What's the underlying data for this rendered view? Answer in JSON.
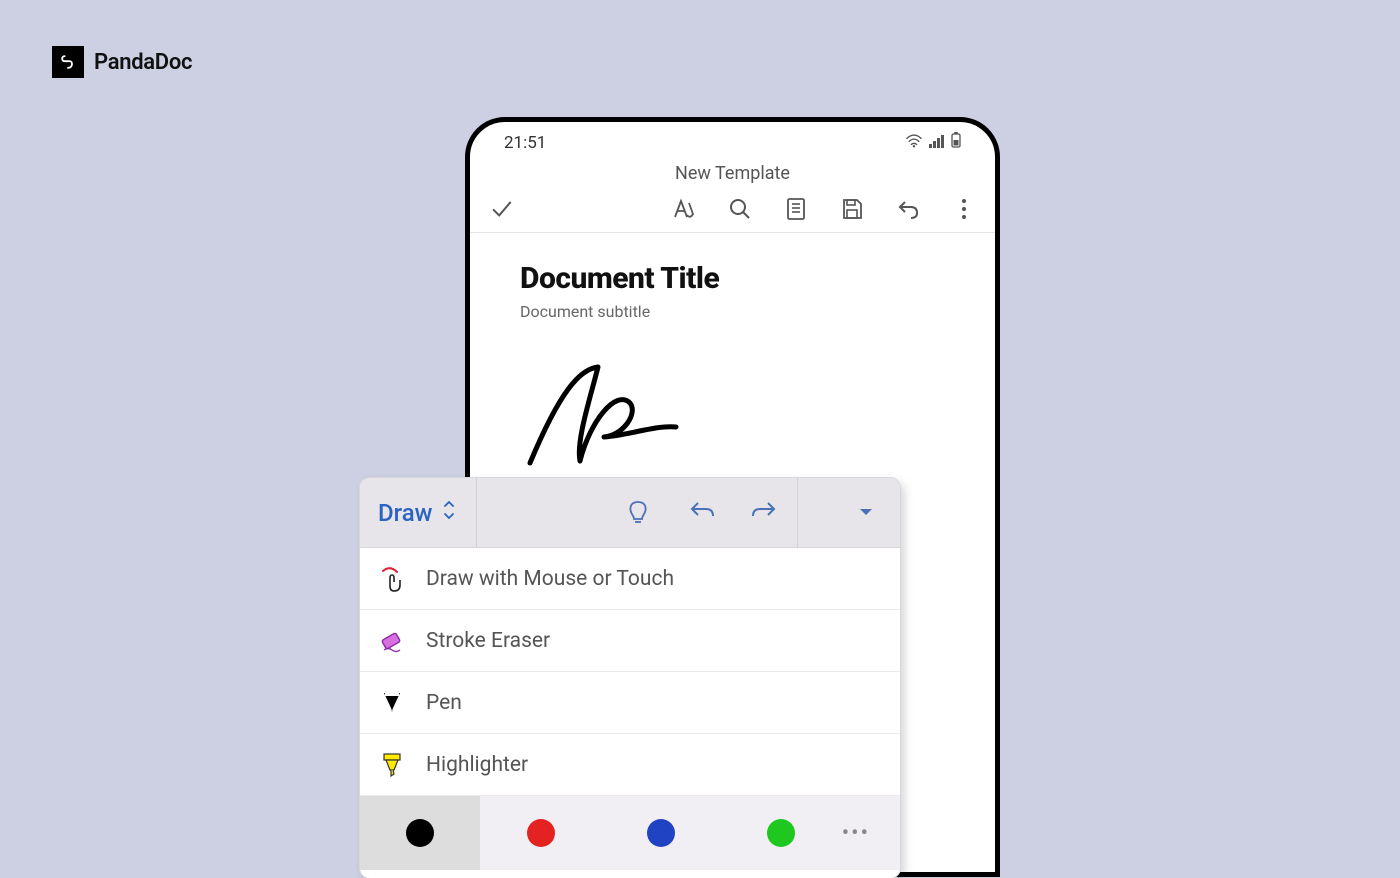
{
  "brand": {
    "name": "PandaDoc"
  },
  "phone": {
    "status": {
      "time": "21:51"
    },
    "screen_title": "New Template",
    "document": {
      "title": "Document Title",
      "subtitle": "Document subtitle"
    }
  },
  "draw_panel": {
    "tab_label": "Draw",
    "menu": {
      "draw_touch": "Draw with Mouse or Touch",
      "stroke_eraser": "Stroke Eraser",
      "pen": "Pen",
      "highlighter": "Highlighter"
    },
    "colors": {
      "black": "#000000",
      "red": "#e42222",
      "blue": "#2043c4",
      "green": "#1ec81e"
    }
  }
}
